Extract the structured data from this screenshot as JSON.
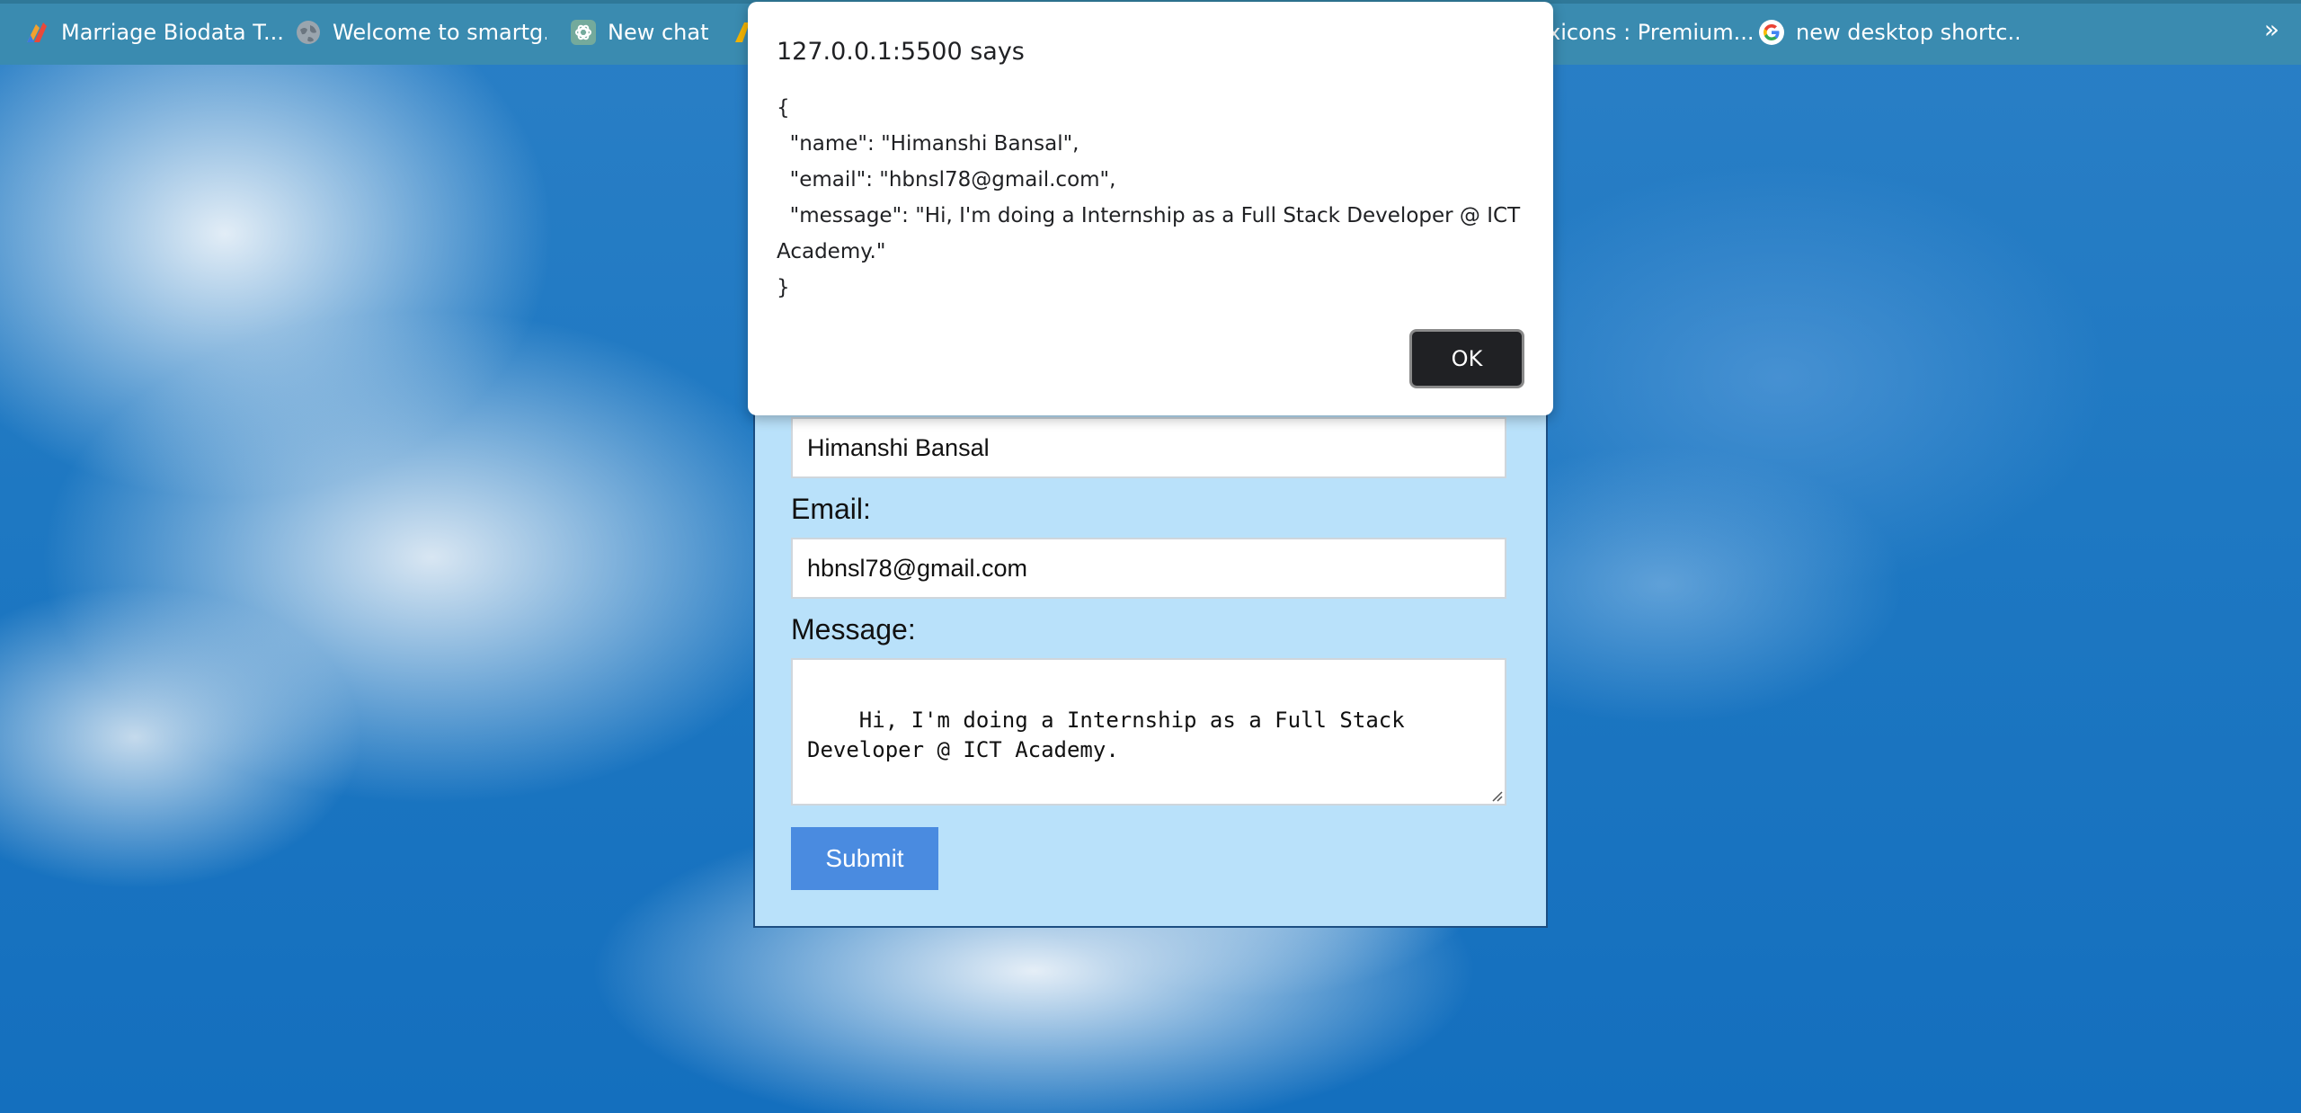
{
  "bookmarks": {
    "items": [
      {
        "label": "Marriage Biodata T...",
        "icon": "marriage-biodata-logo-icon"
      },
      {
        "label": "Welcome to smartg...",
        "icon": "globe-icon"
      },
      {
        "label": "New chat",
        "icon": "chatgpt-logo-icon"
      },
      {
        "label": "",
        "icon": "folder-icon"
      },
      {
        "label": "xicons : Premium...",
        "icon": "xicons-logo-icon"
      },
      {
        "label": "new desktop shortc...",
        "icon": "google-logo-icon"
      }
    ],
    "more_label": "»"
  },
  "dialog": {
    "title": "127.0.0.1:5500 says",
    "lines": [
      "{",
      "  \"name\": \"Himanshi Bansal\",",
      "  \"email\": \"hbnsl78@gmail.com\",",
      "  \"message\": \"Hi, I'm doing a Internship as a Full Stack Developer @ ICT",
      "Academy.\"",
      "}"
    ],
    "ok_label": "OK"
  },
  "form": {
    "name_value": "Himanshi Bansal",
    "email_label": "Email:",
    "email_value": "hbnsl78@gmail.com",
    "message_label": "Message:",
    "message_value": "Hi, I'm doing a Internship as a Full Stack\nDeveloper @ ICT Academy.",
    "submit_label": "Submit"
  },
  "colors": {
    "bookmarks_bar": "#3a8bb0",
    "form_background": "#b9e1fa",
    "form_border": "#1c4e82",
    "submit_button": "#4a8be0",
    "ok_button": "#202124"
  }
}
